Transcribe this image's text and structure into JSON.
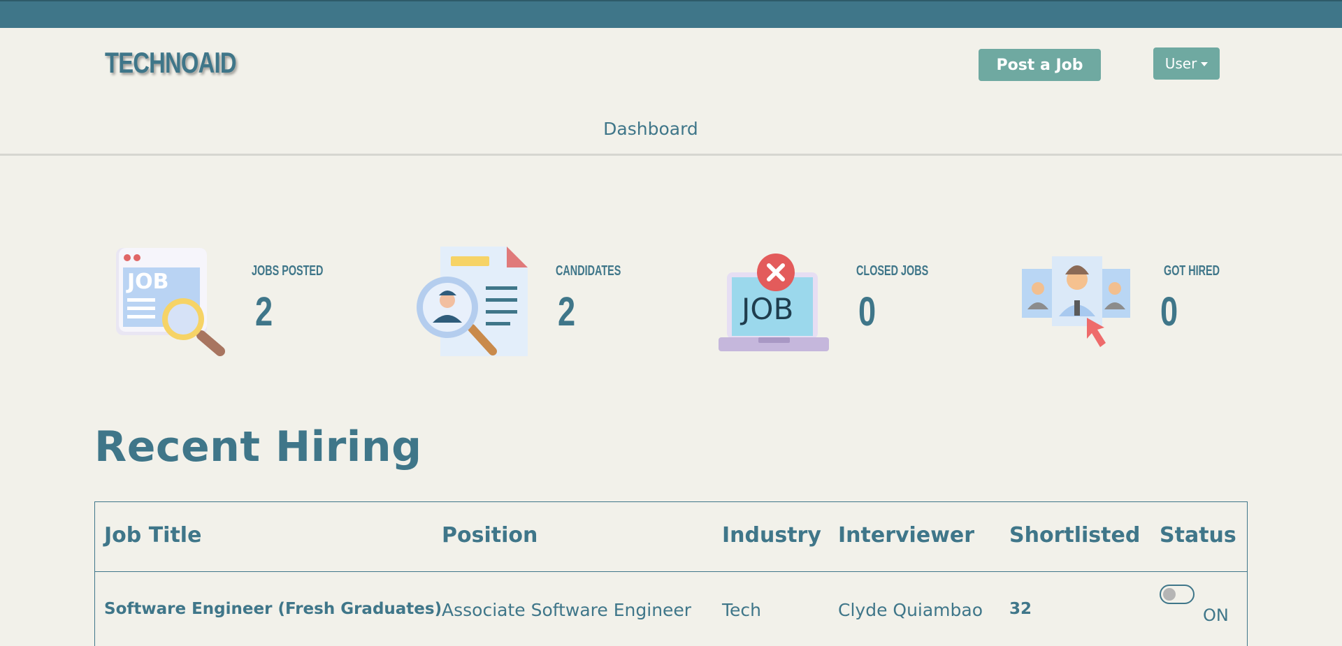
{
  "brand": {
    "logo_text": "TECHNOAID"
  },
  "header": {
    "post_job_label": "Post a Job",
    "user_label": "User",
    "nav_dashboard": "Dashboard"
  },
  "stats": [
    {
      "label": "JOBS POSTED",
      "value": "2",
      "icon": "job-search-icon"
    },
    {
      "label": "CANDIDATES",
      "value": "2",
      "icon": "candidate-search-icon"
    },
    {
      "label": "CLOSED JOBS",
      "value": "0",
      "icon": "closed-job-icon"
    },
    {
      "label": "GOT HIRED",
      "value": "0",
      "icon": "hired-select-icon"
    }
  ],
  "recent": {
    "title": "Recent Hiring",
    "columns": [
      "Job Title",
      "Position",
      "Industry",
      "Interviewer",
      "Shortlisted",
      "Status"
    ],
    "rows": [
      {
        "job_title": "Software Engineer (Fresh Graduates)",
        "position": "Associate Software Engineer",
        "industry": "Tech",
        "interviewer": "Clyde Quiambao",
        "shortlisted": "32",
        "status": "ON"
      }
    ]
  },
  "colors": {
    "background": "#f2f1ea",
    "primary": "#3f7689",
    "button": "#6fa9a1"
  }
}
